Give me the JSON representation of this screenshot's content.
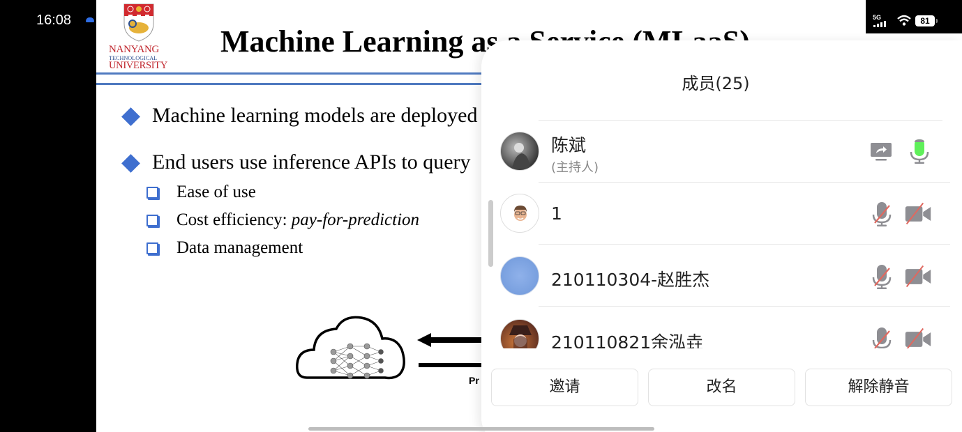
{
  "status_bar": {
    "time": "16:08",
    "network": "5G",
    "battery": "81"
  },
  "slide": {
    "logo": {
      "line1": "NANYANG",
      "line2": "TECHNOLOGICAL",
      "line3": "UNIVERSITY"
    },
    "title": "Machine Learning as a Service (MLaaS)",
    "bullets": [
      "Machine learning models are deployed",
      "End users use inference APIs to query"
    ],
    "sub_bullets": [
      {
        "text": "Ease of use",
        "italic": ""
      },
      {
        "text": "Cost efficiency: ",
        "italic": "pay-for-prediction"
      },
      {
        "text": "Data management",
        "italic": ""
      }
    ],
    "diagram_label": "Pr"
  },
  "panel": {
    "title": "成员(25)",
    "members": [
      {
        "name": "陈斌",
        "role": "(主持人)",
        "avatar": "photo-grayscale",
        "sharing": true,
        "mic": "active",
        "camera": "none"
      },
      {
        "name": "1",
        "role": "",
        "avatar": "memoji",
        "sharing": false,
        "mic": "muted",
        "camera": "off"
      },
      {
        "name": "210110304-赵胜杰",
        "role": "",
        "avatar": "blue-sky",
        "sharing": false,
        "mic": "muted",
        "camera": "off"
      },
      {
        "name": "210110821余泓垚",
        "role": "",
        "avatar": "anime-character",
        "sharing": false,
        "mic": "muted",
        "camera": "off"
      }
    ],
    "actions": {
      "invite": "邀请",
      "rename": "改名",
      "unmute": "解除静音"
    }
  },
  "colors": {
    "accent_blue": "#3f6fcf",
    "mic_active": "#5ff05a",
    "muted_slash": "#e0685f",
    "icon_gray": "#8e8e93"
  }
}
